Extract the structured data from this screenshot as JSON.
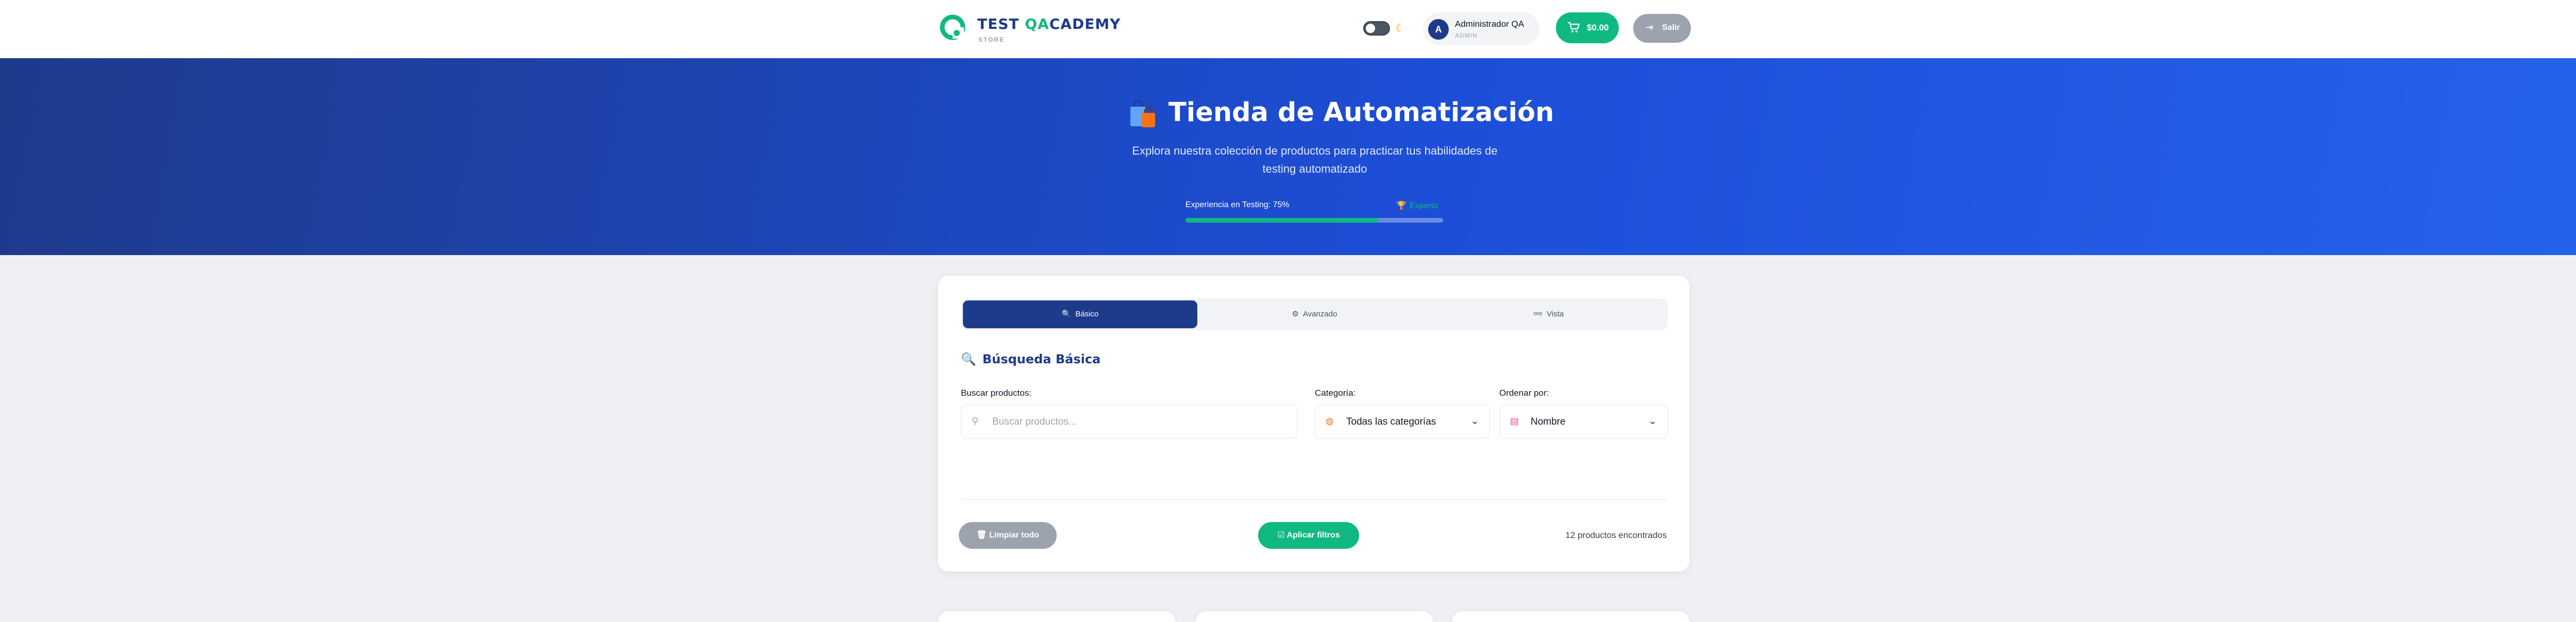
{
  "header": {
    "brand_prefix": "TEST ",
    "brand_accent": "QA",
    "brand_suffix": "CADEMY",
    "brand_sub": "STORE",
    "theme_icon": "moon-icon",
    "user": {
      "initial": "A",
      "name": "Administrador QA",
      "role": "ADMIN"
    },
    "cart": {
      "icon": "cart-icon",
      "total": "$0.00"
    },
    "logout_label": "Salir"
  },
  "hero": {
    "title": "Tienda de Automatización",
    "description": "Explora nuestra colección de productos para practicar tus habilidades de testing automatizado",
    "experience_label": "Experiencia en Testing: 75%",
    "experience_percent": 75,
    "level_badge": "Experto"
  },
  "filters": {
    "tabs": [
      {
        "label": "Básico",
        "icon": "search-icon",
        "active": true
      },
      {
        "label": "Avanzado",
        "icon": "gear-icon",
        "active": false
      },
      {
        "label": "Vista",
        "icon": "view-icon",
        "active": false
      }
    ],
    "section_title": "Búsqueda Básica",
    "search": {
      "label": "Buscar productos:",
      "placeholder": "Buscar productos..."
    },
    "category": {
      "label": "Categoría:",
      "selected": "Todas las categorías"
    },
    "sort": {
      "label": "Ordenar por:",
      "selected": "Nombre"
    },
    "clear_label": "Limpiar todo",
    "apply_label": "Aplicar filtros",
    "results_text": "12 productos encontrados"
  },
  "colors": {
    "primary": "#1e3a8a",
    "accent": "#10b981",
    "muted_button": "#9ca3af"
  }
}
